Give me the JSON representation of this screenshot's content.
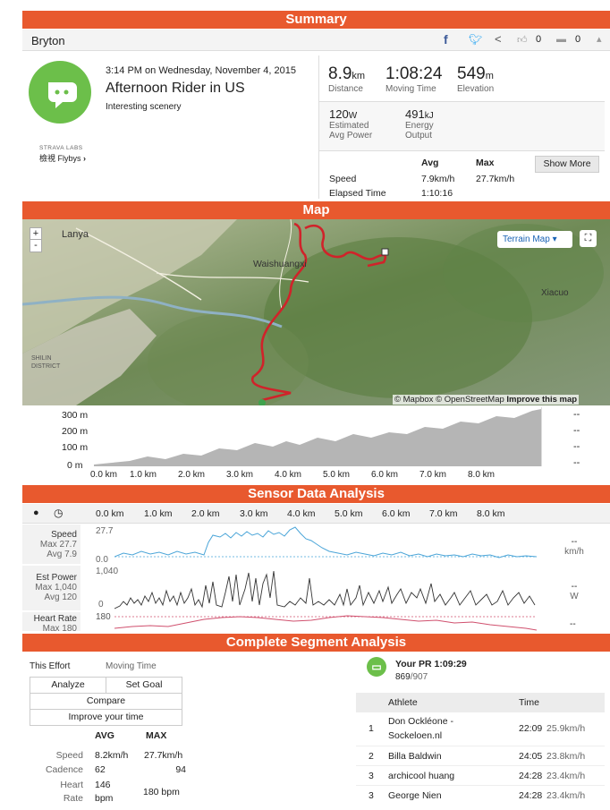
{
  "summary": {
    "band": "Summary",
    "brand": "Bryton",
    "social": {
      "like_count": "0",
      "comment_count": "0"
    },
    "datetime": "3:14 PM on Wednesday, November 4, 2015",
    "title": "Afternoon Rider in US",
    "description": "Interesting scenery",
    "labs": "STRAVA LABS",
    "flybys": "檢視 Flybys",
    "distance_value": "8.9",
    "distance_unit": "km",
    "distance_label": "Distance",
    "moving_time_value": "1:08:24",
    "moving_time_label": "Moving Time",
    "elevation_value": "549",
    "elevation_unit": "m",
    "elevation_label": "Elevation",
    "power_value": "120",
    "power_unit": "W",
    "power_label1": "Estimated",
    "power_label2": "Avg Power",
    "energy_value": "491",
    "energy_unit": "kJ",
    "energy_label1": "Energy",
    "energy_label2": "Output",
    "col_avg": "Avg",
    "col_max": "Max",
    "speed_label": "Speed",
    "speed_avg": "7.9km/h",
    "speed_max": "27.7km/h",
    "elapsed_label": "Elapsed Time",
    "elapsed_value": "1:10:16",
    "show_more": "Show More"
  },
  "map": {
    "band": "Map",
    "zoom_in": "+",
    "zoom_out": "-",
    "layer_button": "Terrain Map",
    "places": [
      "Lanya",
      "Waishuangxi",
      "Xiacuo",
      "SHILIN",
      "DISTRICT"
    ],
    "attribution": "© Mapbox © OpenStreetMap",
    "improve": "Improve this map",
    "elev_ticks": [
      "300 m",
      "200 m",
      "100 m",
      "0 m"
    ],
    "dist_ticks": [
      "0.0 km",
      "1.0 km",
      "2.0 km",
      "3.0 km",
      "4.0 km",
      "5.0 km",
      "6.0 km",
      "7.0 km",
      "8.0 km"
    ],
    "dashes": [
      "--",
      "--",
      "--",
      "--"
    ]
  },
  "sensor": {
    "band": "Sensor Data Analysis",
    "dist_ticks": [
      "0.0 km",
      "1.0 km",
      "2.0 km",
      "3.0 km",
      "4.0 km",
      "5.0 km",
      "6.0 km",
      "7.0 km",
      "8.0 km"
    ],
    "speed": {
      "title": "Speed",
      "max": "Max 27.7",
      "avg": "Avg 7.9",
      "top": "27.7",
      "bottom": "0.0",
      "unit_dash": "--",
      "unit": "km/h"
    },
    "power": {
      "title": "Est Power",
      "max": "Max 1,040",
      "avg": "Avg 120",
      "top": "1,040",
      "bottom": "0",
      "unit_dash": "--",
      "unit": "W"
    },
    "heart": {
      "title": "Heart Rate",
      "max": "Max 180",
      "top": "180",
      "unit_dash": "--"
    }
  },
  "segment": {
    "band": "Complete Segment Analysis",
    "this_effort": "This Effort",
    "moving_time": "Moving Time",
    "analyze": "Analyze",
    "set_goal": "Set Goal",
    "compare": "Compare",
    "improve": "Improve your time",
    "col_avg": "AVG",
    "col_max": "MAX",
    "rows": [
      {
        "label": "Speed",
        "avg": "8.2km/h",
        "max": "27.7km/h"
      },
      {
        "label": "Cadence",
        "avg": "62",
        "max": "94"
      },
      {
        "label": "Heart",
        "label2": "Rate",
        "avg": "146",
        "avg2": "bpm",
        "max": "180 bpm"
      }
    ],
    "pr": "Your PR 1:09:29",
    "rank": "869",
    "rank_total": "/907",
    "leader_cols": {
      "athlete": "Athlete",
      "time": "Time"
    },
    "leaders": [
      {
        "rank": "1",
        "name": "Don Ockléone -",
        "name2": "Sockeloen.nl",
        "time": "22:09",
        "speed": "25.9km/h"
      },
      {
        "rank": "2",
        "name": "Billa Baldwin",
        "time": "24:05",
        "speed": "23.8km/h"
      },
      {
        "rank": "3",
        "name": "archicool huang",
        "time": "24:28",
        "speed": "23.4km/h"
      },
      {
        "rank": "3",
        "name": "George Nien",
        "time": "24:28",
        "speed": "23.4km/h"
      }
    ]
  }
}
